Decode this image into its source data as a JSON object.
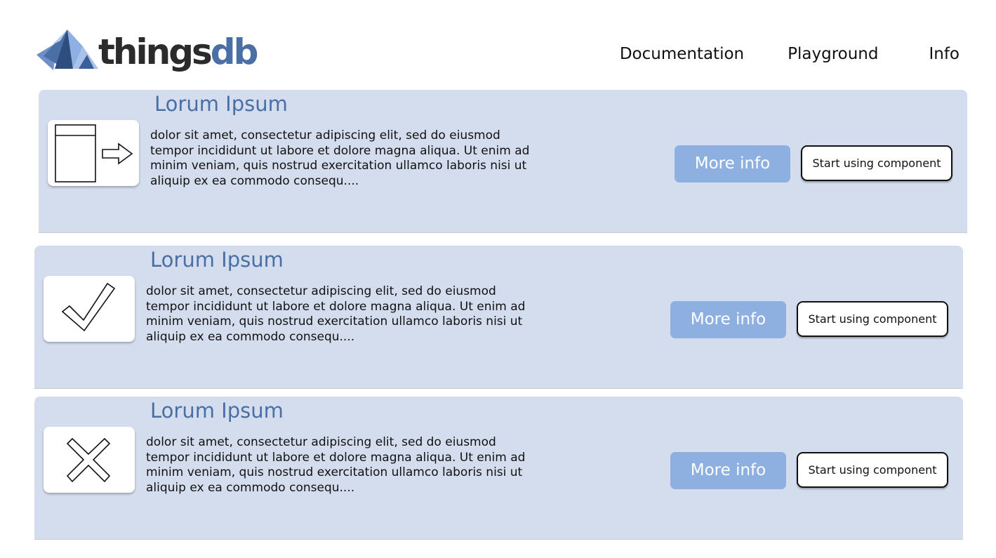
{
  "header": {
    "logo": {
      "text_primary": "things",
      "text_secondary": "db",
      "icon": "thingsdb-logo-mark"
    },
    "nav": [
      {
        "label": "Documentation"
      },
      {
        "label": "Playground"
      },
      {
        "label": "Info"
      }
    ]
  },
  "colors": {
    "card_background": "#d4ddee",
    "title": "#4a6fa5",
    "more_info_button": "#8eb0e0",
    "logo_dark": "#2b2b2b",
    "logo_accent": "#4a6fa5"
  },
  "components": [
    {
      "title": "Lorum Ipsum",
      "icon": "export-arrow-icon",
      "description": "dolor sit amet, consectetur adipiscing elit, sed do eiusmod tempor incididunt ut labore et dolore magna aliqua. Ut enim ad minim veniam, quis nostrud exercitation ullamco laboris nisi ut aliquip ex ea commodo consequ....",
      "more_info_label": "More info",
      "start_label": "Start using component"
    },
    {
      "title": "Lorum Ipsum",
      "icon": "checkmark-icon",
      "description": "dolor sit amet, consectetur adipiscing elit, sed do eiusmod tempor incididunt ut labore et dolore magna aliqua. Ut enim ad minim veniam, quis nostrud exercitation ullamco laboris nisi ut aliquip ex ea commodo consequ....",
      "more_info_label": "More info",
      "start_label": "Start using component"
    },
    {
      "title": "Lorum Ipsum",
      "icon": "cross-icon",
      "description": "dolor sit amet, consectetur adipiscing elit, sed do eiusmod tempor incididunt ut labore et dolore magna aliqua. Ut enim ad minim veniam, quis nostrud exercitation ullamco laboris nisi ut aliquip ex ea commodo consequ....",
      "more_info_label": "More info",
      "start_label": "Start using component"
    }
  ]
}
